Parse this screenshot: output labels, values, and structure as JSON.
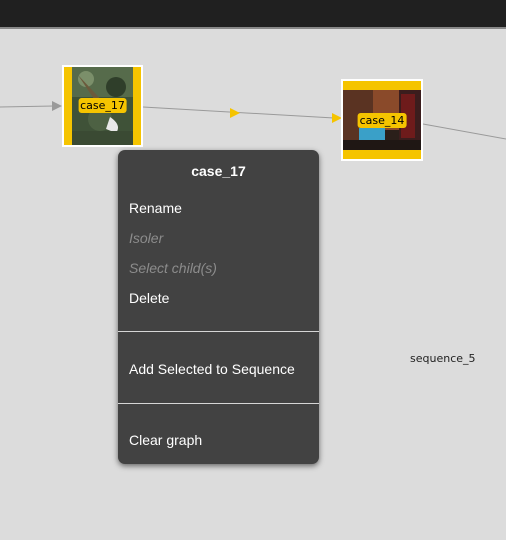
{
  "nodes": [
    {
      "id": "case_17",
      "label": "case_17"
    },
    {
      "id": "case_14",
      "label": "case_14"
    }
  ],
  "sequence_label": "sequence_5",
  "context_menu": {
    "title": "case_17",
    "items": [
      {
        "label": "Rename",
        "enabled": true
      },
      {
        "label": "Isoler",
        "enabled": false
      },
      {
        "label": "Select child(s)",
        "enabled": false
      },
      {
        "label": "Delete",
        "enabled": true
      },
      {
        "label": "Add Selected to Sequence",
        "enabled": true
      },
      {
        "label": "Clear graph",
        "enabled": true
      }
    ]
  },
  "colors": {
    "node_fill": "#f5c400",
    "node_border": "#ffffff",
    "edge": "#9a9a9a",
    "edge_arrow_mid": "#f5c400",
    "menu_bg": "#424242",
    "canvas_bg": "#dcdcdc",
    "topbar_bg": "#202020"
  }
}
